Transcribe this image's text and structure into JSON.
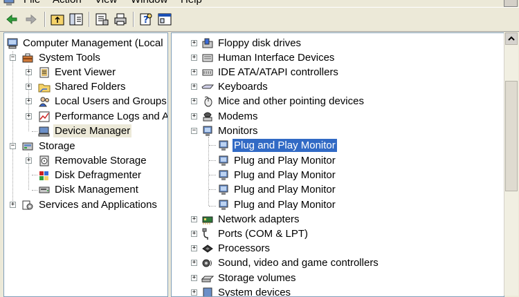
{
  "menubar": {
    "items": [
      {
        "label": "File"
      },
      {
        "label": "Action"
      },
      {
        "label": "View"
      },
      {
        "label": "Window"
      },
      {
        "label": "Help"
      }
    ]
  },
  "toolbar": {
    "buttons": [
      {
        "icon": "back-arrow-icon"
      },
      {
        "icon": "forward-arrow-icon"
      },
      {
        "icon": "up-folder-icon"
      },
      {
        "icon": "show-hide-tree-icon"
      },
      {
        "icon": "properties-icon"
      },
      {
        "icon": "print-icon"
      },
      {
        "icon": "help-icon"
      },
      {
        "icon": "console-window-icon"
      }
    ]
  },
  "tree": {
    "root": "Computer Management (Local",
    "system_tools": "System Tools",
    "event_viewer": "Event Viewer",
    "shared_folders": "Shared Folders",
    "local_users": "Local Users and Groups",
    "perf_logs": "Performance Logs and A",
    "device_manager": "Device Manager",
    "storage": "Storage",
    "removable_storage": "Removable Storage",
    "disk_defrag": "Disk Defragmenter",
    "disk_mgmt": "Disk Management",
    "services_apps": "Services and Applications"
  },
  "devices": {
    "floppy": "Floppy disk drives",
    "hid": "Human Interface Devices",
    "ide": "IDE ATA/ATAPI controllers",
    "keyboards": "Keyboards",
    "mice": "Mice and other pointing devices",
    "modems": "Modems",
    "monitors": "Monitors",
    "monitor_items": [
      "Plug and Play Monitor",
      "Plug and Play Monitor",
      "Plug and Play Monitor",
      "Plug and Play Monitor",
      "Plug and Play Monitor"
    ],
    "network": "Network adapters",
    "ports": "Ports (COM & LPT)",
    "processors": "Processors",
    "sound": "Sound, video and game controllers",
    "storage_vol": "Storage volumes",
    "system_dev": "System devices"
  },
  "colors": {
    "selection": "#316ac5",
    "window_bg": "#ece9d8",
    "pane_border": "#7f9db9"
  }
}
